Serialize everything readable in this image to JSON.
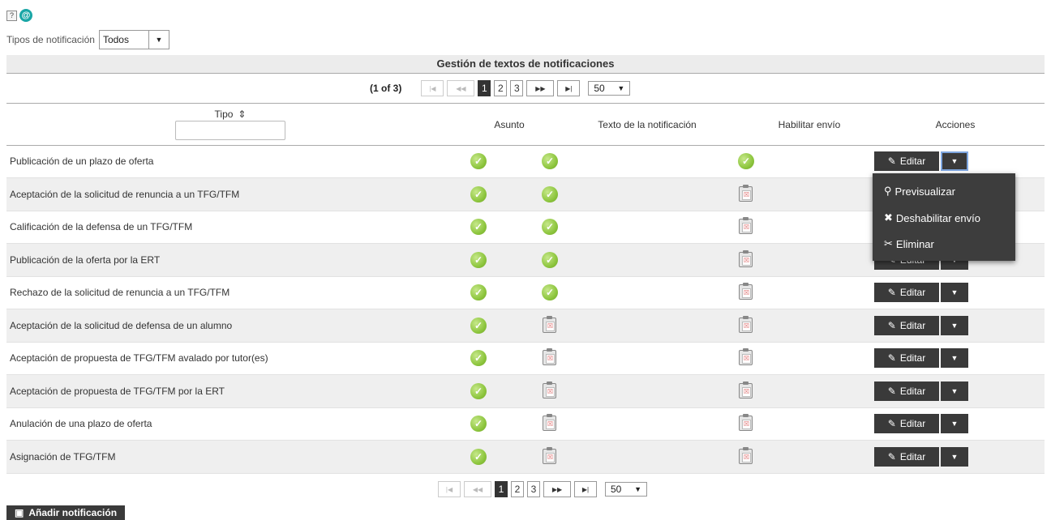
{
  "top_icons": {
    "help": "?",
    "at": "@"
  },
  "filter": {
    "label": "Tipos de notificación",
    "value": "Todos"
  },
  "table": {
    "title": "Gestión de textos de notificaciones",
    "pager": {
      "info": "(1 of 3)",
      "first": "|◀",
      "prev": "◀◀",
      "pages": [
        "1",
        "2",
        "3"
      ],
      "active_page": "1",
      "next": "▶▶",
      "last": "▶|",
      "rows_per_page": "50"
    },
    "columns": {
      "tipo": "Tipo",
      "sort": "⇕",
      "asunto": "Asunto",
      "texto": "Texto de la notificación",
      "habilitar": "Habilitar envío",
      "acciones": "Acciones"
    },
    "rows": [
      {
        "name": "Publicación de un plazo de oferta",
        "asunto": true,
        "texto": true,
        "habilitar": true
      },
      {
        "name": "Aceptación de la solicitud de renuncia a un TFG/TFM",
        "asunto": true,
        "texto": true,
        "habilitar": false
      },
      {
        "name": "Calificación de la defensa de un TFG/TFM",
        "asunto": true,
        "texto": true,
        "habilitar": false
      },
      {
        "name": "Publicación de la oferta por la ERT",
        "asunto": true,
        "texto": true,
        "habilitar": false
      },
      {
        "name": "Rechazo de la solicitud de renuncia a un TFG/TFM",
        "asunto": true,
        "texto": true,
        "habilitar": false
      },
      {
        "name": "Aceptación de la solicitud de defensa de un alumno",
        "asunto": true,
        "texto": false,
        "habilitar": false
      },
      {
        "name": "Aceptación de propuesta de TFG/TFM avalado por tutor(es)",
        "asunto": true,
        "texto": false,
        "habilitar": false
      },
      {
        "name": "Aceptación de propuesta de TFG/TFM por la ERT",
        "asunto": true,
        "texto": false,
        "habilitar": false
      },
      {
        "name": "Anulación de una plazo de oferta",
        "asunto": true,
        "texto": false,
        "habilitar": false
      },
      {
        "name": "Asignación de TFG/TFM",
        "asunto": true,
        "texto": false,
        "habilitar": false
      }
    ],
    "edit_label": "Editar"
  },
  "menu": {
    "preview": "Previsualizar",
    "disable": "Deshabilitar envío",
    "delete": "Eliminar"
  },
  "add_button": "Añadir notificación"
}
